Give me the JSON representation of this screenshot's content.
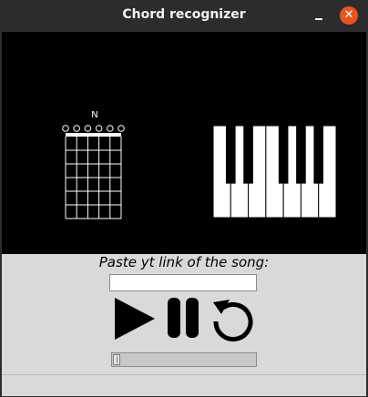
{
  "window": {
    "title": "Chord recognizer",
    "minimize_glyph": "–",
    "close_glyph": "✕"
  },
  "guitar": {
    "chord_name": "N",
    "strings": 6,
    "frets": 6,
    "open_strings": [
      "open",
      "open",
      "open",
      "open",
      "open",
      "open"
    ]
  },
  "piano": {
    "white_keys": 7
  },
  "controls": {
    "prompt": "Paste yt link of the song:",
    "link_value": "",
    "play_icon": "play-icon",
    "pause_icon": "pause-icon",
    "restart_icon": "restart-icon",
    "progress": 0
  },
  "colors": {
    "titlebar": "#2c2c2c",
    "canvas": "#000000",
    "panel": "#d9d9d9",
    "close": "#e95420"
  }
}
